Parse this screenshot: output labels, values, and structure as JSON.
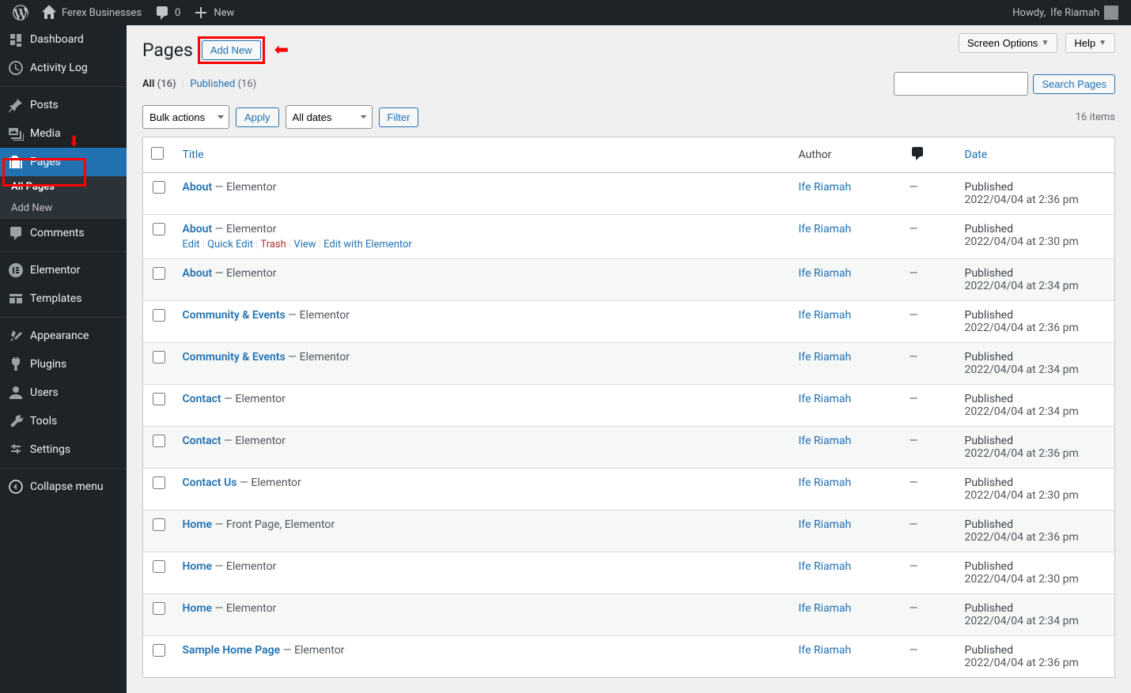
{
  "adminbar": {
    "site_name": "Ferex Businesses",
    "comments_count": "0",
    "new_label": "New",
    "howdy_prefix": "Howdy,",
    "user_name": "Ife Riamah"
  },
  "sidebar": {
    "items": [
      {
        "id": "dashboard",
        "label": "Dashboard"
      },
      {
        "id": "activity",
        "label": "Activity Log"
      },
      {
        "id": "posts",
        "label": "Posts"
      },
      {
        "id": "media",
        "label": "Media"
      },
      {
        "id": "pages",
        "label": "Pages"
      },
      {
        "id": "comments",
        "label": "Comments"
      },
      {
        "id": "elementor",
        "label": "Elementor"
      },
      {
        "id": "templates",
        "label": "Templates"
      },
      {
        "id": "appearance",
        "label": "Appearance"
      },
      {
        "id": "plugins",
        "label": "Plugins"
      },
      {
        "id": "users",
        "label": "Users"
      },
      {
        "id": "tools",
        "label": "Tools"
      },
      {
        "id": "settings",
        "label": "Settings"
      },
      {
        "id": "collapse",
        "label": "Collapse menu"
      }
    ],
    "pages_sub": {
      "all": "All Pages",
      "new": "Add New"
    }
  },
  "top_panels": {
    "screen_options": "Screen Options",
    "help": "Help"
  },
  "heading": {
    "title": "Pages",
    "add_new": "Add New"
  },
  "views": {
    "all_label": "All",
    "all_count": "(16)",
    "published_label": "Published",
    "published_count": "(16)"
  },
  "search": {
    "button": "Search Pages"
  },
  "filters": {
    "bulk": "Bulk actions",
    "apply": "Apply",
    "dates": "All dates",
    "filter": "Filter",
    "items_count": "16 items"
  },
  "columns": {
    "title": "Title",
    "author": "Author",
    "date": "Date"
  },
  "row_actions": {
    "edit": "Edit",
    "quick": "Quick Edit",
    "trash": "Trash",
    "view": "View",
    "elementor": "Edit with Elementor"
  },
  "rows": [
    {
      "title": "About",
      "suffix": " — Elementor",
      "author": "Ife Riamah",
      "status": "Published",
      "date": "2022/04/04 at 2:36 pm",
      "actions": false
    },
    {
      "title": "About",
      "suffix": " — Elementor",
      "author": "Ife Riamah",
      "status": "Published",
      "date": "2022/04/04 at 2:30 pm",
      "actions": true
    },
    {
      "title": "About",
      "suffix": " — Elementor",
      "author": "Ife Riamah",
      "status": "Published",
      "date": "2022/04/04 at 2:34 pm",
      "actions": false
    },
    {
      "title": "Community & Events",
      "suffix": " — Elementor",
      "author": "Ife Riamah",
      "status": "Published",
      "date": "2022/04/04 at 2:36 pm",
      "actions": false
    },
    {
      "title": "Community & Events",
      "suffix": " — Elementor",
      "author": "Ife Riamah",
      "status": "Published",
      "date": "2022/04/04 at 2:34 pm",
      "actions": false
    },
    {
      "title": "Contact",
      "suffix": " — Elementor",
      "author": "Ife Riamah",
      "status": "Published",
      "date": "2022/04/04 at 2:34 pm",
      "actions": false
    },
    {
      "title": "Contact",
      "suffix": " — Elementor",
      "author": "Ife Riamah",
      "status": "Published",
      "date": "2022/04/04 at 2:36 pm",
      "actions": false
    },
    {
      "title": "Contact Us",
      "suffix": " — Elementor",
      "author": "Ife Riamah",
      "status": "Published",
      "date": "2022/04/04 at 2:30 pm",
      "actions": false
    },
    {
      "title": "Home",
      "suffix": " — Front Page, Elementor",
      "author": "Ife Riamah",
      "status": "Published",
      "date": "2022/04/04 at 2:36 pm",
      "actions": false
    },
    {
      "title": "Home",
      "suffix": " — Elementor",
      "author": "Ife Riamah",
      "status": "Published",
      "date": "2022/04/04 at 2:30 pm",
      "actions": false
    },
    {
      "title": "Home",
      "suffix": " — Elementor",
      "author": "Ife Riamah",
      "status": "Published",
      "date": "2022/04/04 at 2:34 pm",
      "actions": false
    },
    {
      "title": "Sample Home Page",
      "suffix": " — Elementor",
      "author": "Ife Riamah",
      "status": "Published",
      "date": "2022/04/04 at 2:36 pm",
      "actions": false
    }
  ]
}
